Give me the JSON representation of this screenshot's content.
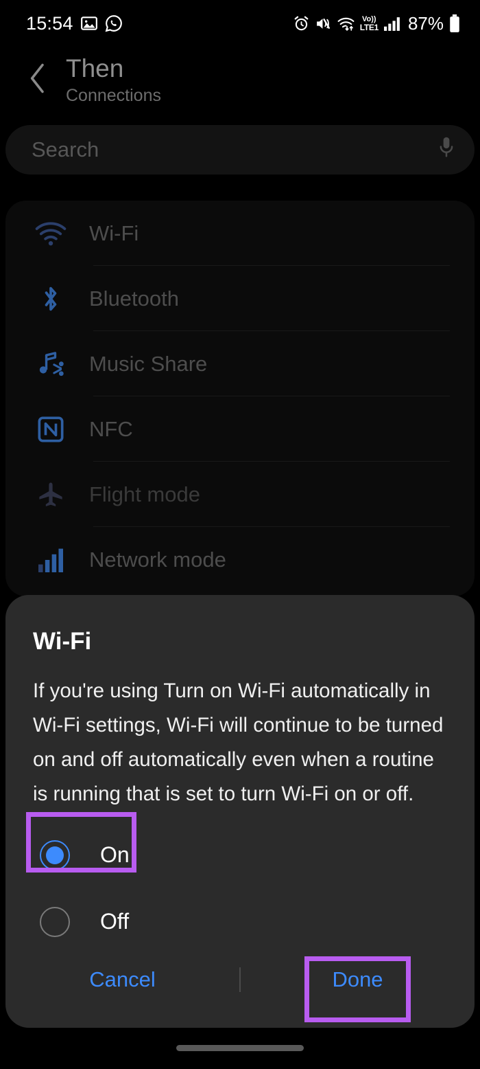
{
  "status_bar": {
    "time": "15:54",
    "left_icons": [
      "gallery-icon",
      "whatsapp-icon"
    ],
    "right_icons": [
      "alarm-icon",
      "mute-vibrate-icon",
      "wifi-transfer-icon",
      "volte-icon",
      "signal-bars-icon"
    ],
    "volte_line1": "Vo))",
    "volte_line2": "LTE1",
    "battery_percent": "87%"
  },
  "app_bar": {
    "back_icon": "chevron-left-icon",
    "title": "Then",
    "subtitle": "Connections"
  },
  "search": {
    "placeholder": "Search",
    "mic_icon": "microphone-icon"
  },
  "settings_list": {
    "items": [
      {
        "label": "Wi-Fi",
        "icon": "wifi-icon",
        "dimmed": false
      },
      {
        "label": "Bluetooth",
        "icon": "bluetooth-icon",
        "dimmed": false
      },
      {
        "label": "Music Share",
        "icon": "music-share-icon",
        "dimmed": false
      },
      {
        "label": "NFC",
        "icon": "nfc-icon",
        "dimmed": false
      },
      {
        "label": "Flight mode",
        "icon": "airplane-icon",
        "dimmed": true
      },
      {
        "label": "Network mode",
        "icon": "signal-bars-icon",
        "dimmed": false
      }
    ]
  },
  "dialog": {
    "title": "Wi-Fi",
    "body": "If you're using Turn on Wi-Fi automatically in Wi-Fi settings, Wi-Fi will continue to be turned on and off automatically even when a routine is running that is set to turn Wi-Fi on or off.",
    "options": [
      {
        "label": "On",
        "selected": true
      },
      {
        "label": "Off",
        "selected": false
      }
    ],
    "cancel_label": "Cancel",
    "done_label": "Done"
  },
  "annotations": {
    "color": "#b85cf0",
    "boxes": [
      "on-radio-option",
      "done-button"
    ]
  },
  "colors": {
    "accent_blue": "#3d8bfd",
    "dialog_bg": "#2b2b2b",
    "page_bg": "#000000",
    "panel_bg": "#0b0b0b",
    "search_bg": "#131313",
    "annotation_purple": "#b85cf0"
  },
  "nav": {
    "handle": "gesture-nav-handle"
  }
}
